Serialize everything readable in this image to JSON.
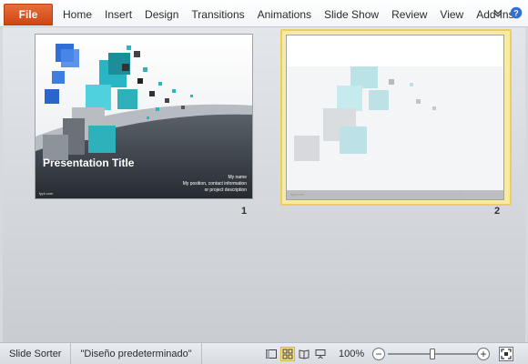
{
  "ribbon": {
    "file_label": "File",
    "tabs": [
      "Home",
      "Insert",
      "Design",
      "Transitions",
      "Animations",
      "Slide Show",
      "Review",
      "View",
      "Add-Ins"
    ],
    "icons": [
      "chevron-down-icon",
      "help-icon"
    ]
  },
  "slides": [
    {
      "number": "1",
      "title": "Presentation Title",
      "subtitle_lines": [
        "My name",
        "My position, contact information",
        "or project description"
      ],
      "footer": "fppt.com",
      "selected": false
    },
    {
      "number": "2",
      "footer": "fppt.com",
      "selected": true
    }
  ],
  "statusbar": {
    "view_name": "Slide Sorter",
    "theme": "\"Diseño predeterminado\"",
    "zoom": "100%",
    "zoom_level": 0.5,
    "view_icons": [
      "normal-view-icon",
      "slide-sorter-icon",
      "reading-view-icon",
      "slideshow-icon"
    ],
    "zoom_out": "−",
    "zoom_in": "+"
  },
  "colors": {
    "file_tab": "#cf4511",
    "selection": "#e8cf61",
    "accent_cyan": "#29b6c4",
    "accent_blue": "#2f6fd6"
  }
}
